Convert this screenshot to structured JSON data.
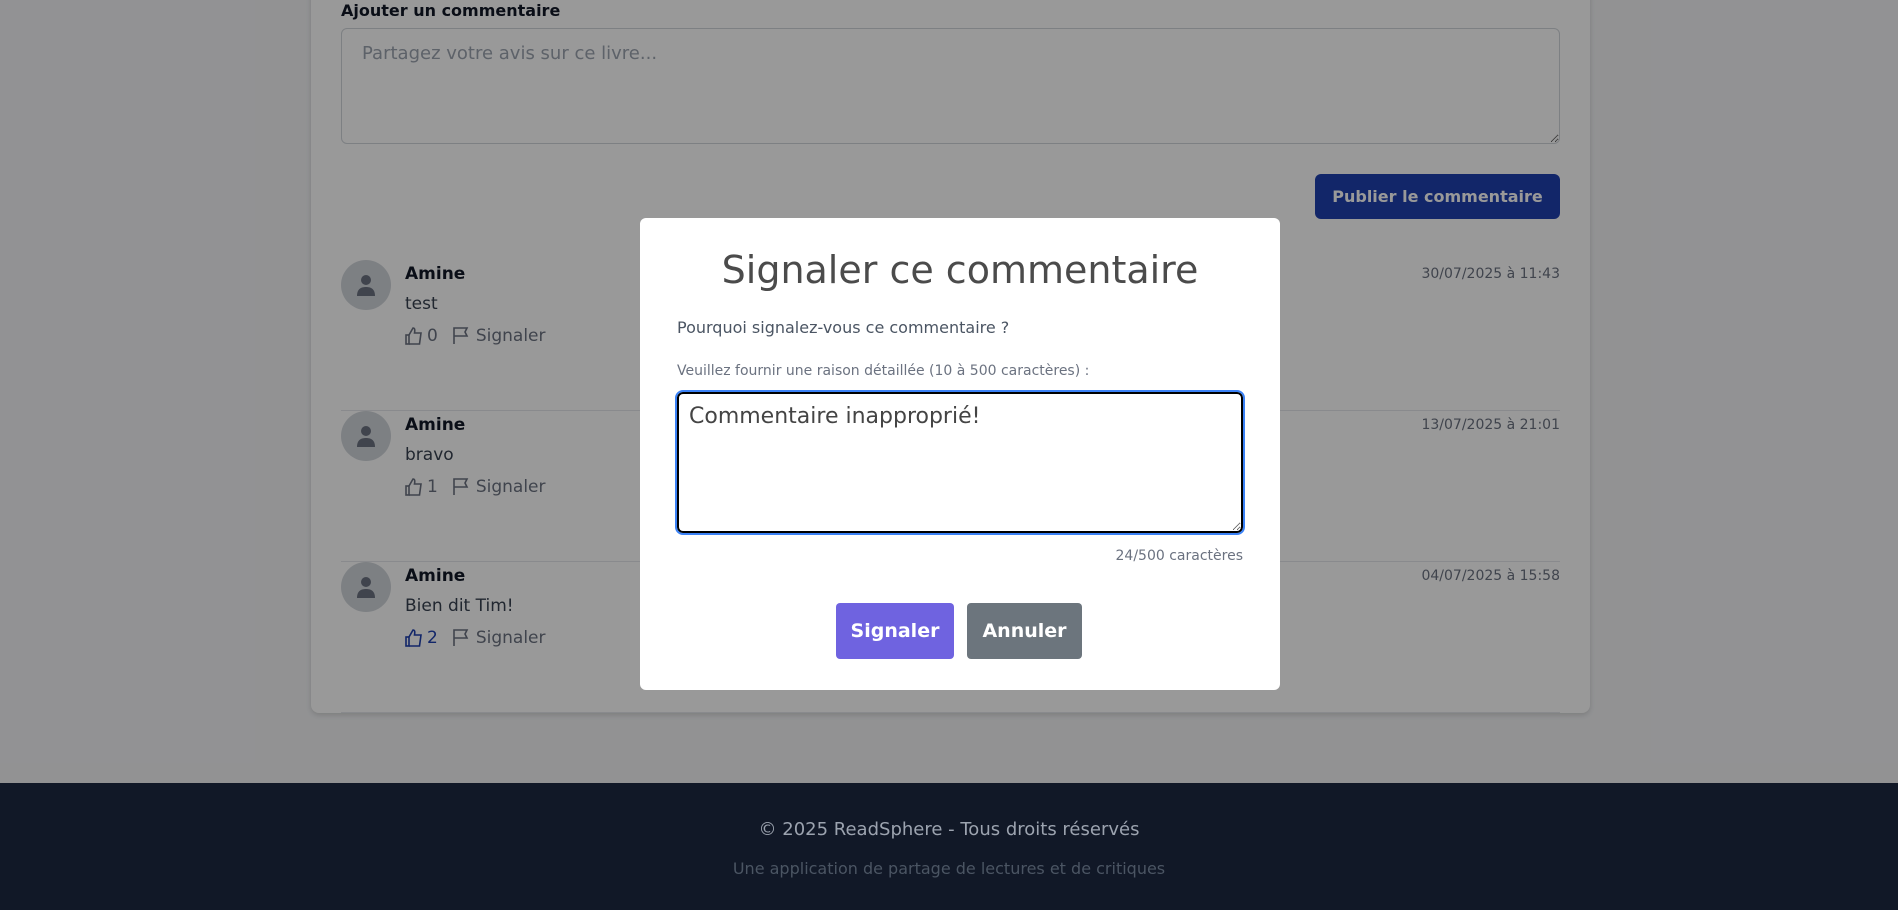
{
  "comment_form": {
    "label": "Ajouter un commentaire",
    "placeholder": "Partagez votre avis sur ce livre...",
    "submit_label": "Publier le commentaire"
  },
  "comments": [
    {
      "author": "Amine",
      "text": "test",
      "likes": "0",
      "liked": false,
      "report_label": "Signaler",
      "date": "30/07/2025 à 11:43"
    },
    {
      "author": "Amine",
      "text": "bravo",
      "likes": "1",
      "liked": false,
      "report_label": "Signaler",
      "date": "13/07/2025 à 21:01"
    },
    {
      "author": "Amine",
      "text": "Bien dit Tim!",
      "likes": "2",
      "liked": true,
      "report_label": "Signaler",
      "date": "04/07/2025 à 15:58"
    }
  ],
  "report_modal": {
    "title": "Signaler ce commentaire",
    "question": "Pourquoi signalez-vous ce commentaire ?",
    "label": "Veuillez fournir une raison détaillée (10 à 500 caractères) :",
    "value": "Commentaire inapproprié!",
    "counter": "24/500 caractères",
    "submit_label": "Signaler",
    "cancel_label": "Annuler",
    "submit_color": "#6f63e0",
    "cancel_color": "#6c757d"
  },
  "footer": {
    "copyright": "© 2025 ReadSphere - Tous droits réservés",
    "tagline": "Une application de partage de lectures et de critiques"
  }
}
